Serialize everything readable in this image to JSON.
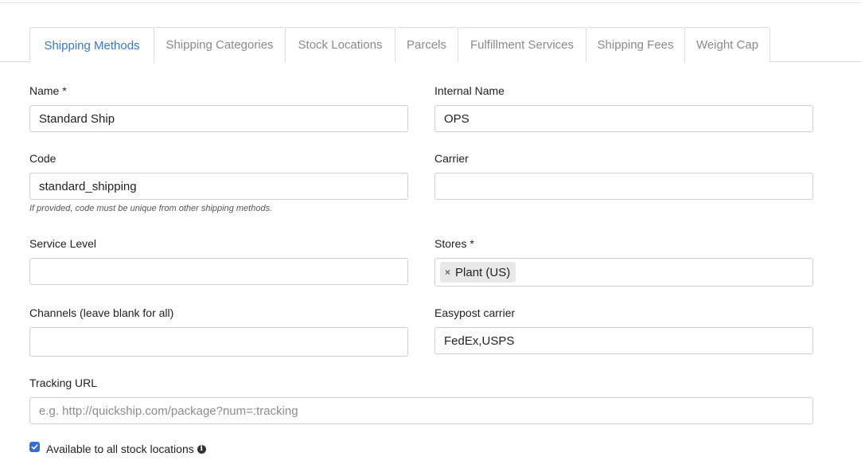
{
  "tabs": [
    {
      "label": "Shipping Methods",
      "active": true
    },
    {
      "label": "Shipping Categories",
      "active": false
    },
    {
      "label": "Stock Locations",
      "active": false
    },
    {
      "label": "Parcels",
      "active": false
    },
    {
      "label": "Fulfillment Services",
      "active": false
    },
    {
      "label": "Shipping Fees",
      "active": false
    },
    {
      "label": "Weight Cap",
      "active": false
    }
  ],
  "form": {
    "name": {
      "label": "Name *",
      "value": "Standard Ship"
    },
    "internal_name": {
      "label": "Internal Name",
      "value": "OPS"
    },
    "code": {
      "label": "Code",
      "value": "standard_shipping",
      "help": "If provided, code must be unique from other shipping methods."
    },
    "carrier": {
      "label": "Carrier",
      "value": ""
    },
    "service_level": {
      "label": "Service Level",
      "value": ""
    },
    "stores": {
      "label": "Stores *",
      "selected": [
        "Plant (US)"
      ],
      "remove_glyph": "×"
    },
    "channels": {
      "label": "Channels (leave blank for all)",
      "value": ""
    },
    "easypost_carrier": {
      "label": "Easypost carrier",
      "value": "FedEx,USPS"
    },
    "tracking_url": {
      "label": "Tracking URL",
      "value": "",
      "placeholder": "e.g. http://quickship.com/package?num=:tracking"
    },
    "available_all": {
      "label": "Available to all stock locations",
      "checked": true,
      "info_glyph": "i"
    }
  },
  "colors": {
    "accent": "#3a78c9",
    "checkbox": "#2f6fd6",
    "border": "#cfcfcf"
  }
}
